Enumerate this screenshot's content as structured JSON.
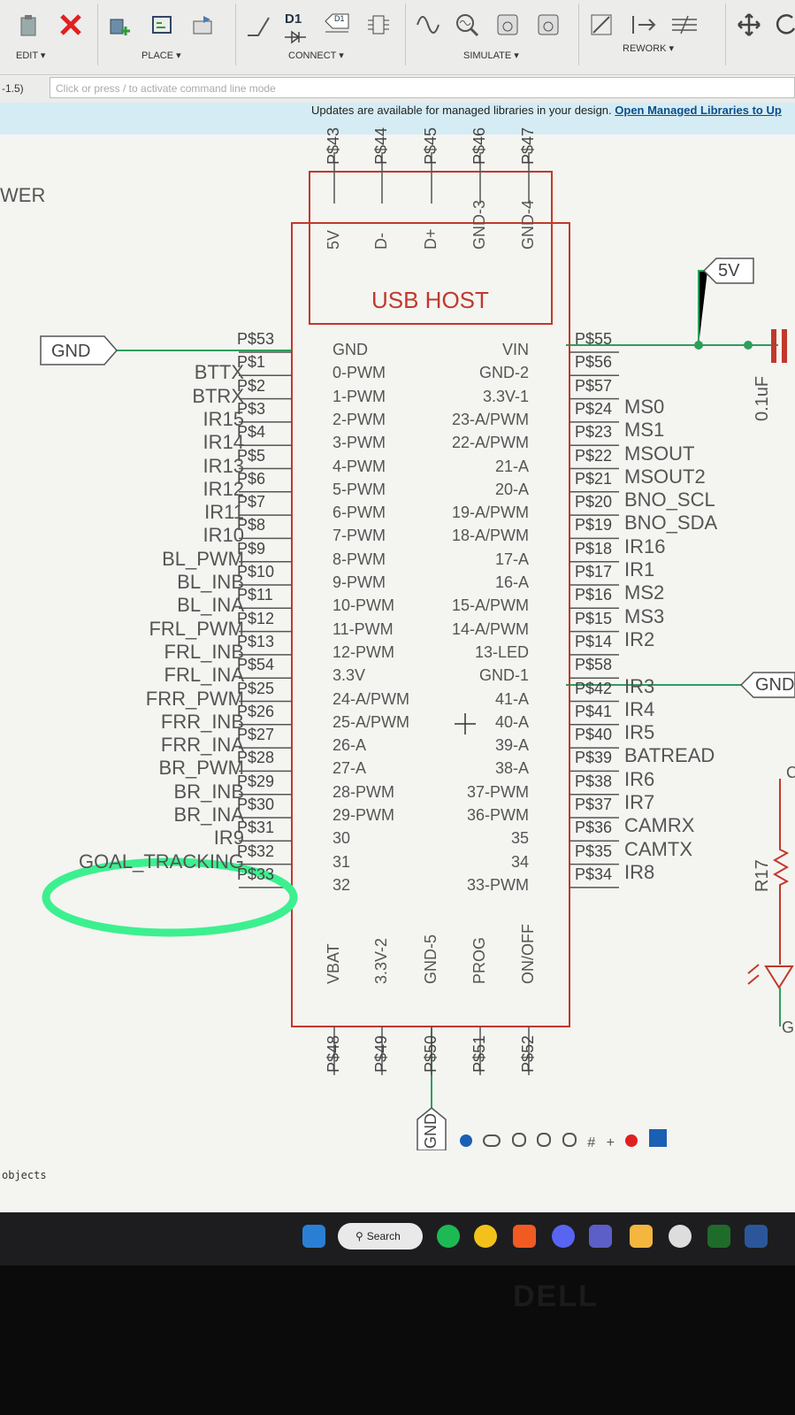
{
  "toolbar": {
    "edit_label": "EDIT ▾",
    "place_label": "PLACE ▾",
    "connect_label": "CONNECT ▾",
    "simulate_label": "SIMULATE ▾",
    "rework_label": "REWORK ▾",
    "d1_label": "D1",
    "d1_box_label": "D1"
  },
  "command": {
    "coordinate": "-1.5)",
    "placeholder": "Click or press / to activate command line mode"
  },
  "banner": {
    "text": "Updates are available for managed libraries in your design.",
    "link": "Open Managed Libraries to Up"
  },
  "schematic": {
    "frame_label": "WER",
    "usb_host_title": "USB HOST",
    "usb_pins": [
      "5V",
      "D-",
      "D+",
      "GND-3",
      "GND-4"
    ],
    "usb_pads": [
      "P$43",
      "P$44",
      "P$45",
      "P$46",
      "P$47"
    ],
    "left_port": "GND",
    "right_port_5v": "5V",
    "right_port_gnd": "GND",
    "bottom_port": "GND",
    "capacitor_value": "0.1uF",
    "resistor_name": "R17",
    "right_edge_letter_g": "G",
    "right_edge_letter_c": "C",
    "left_pins": [
      "GND",
      "0-PWM",
      "1-PWM",
      "2-PWM",
      "3-PWM",
      "4-PWM",
      "5-PWM",
      "6-PWM",
      "7-PWM",
      "8-PWM",
      "9-PWM",
      "10-PWM",
      "11-PWM",
      "12-PWM",
      "3.3V",
      "24-A/PWM",
      "25-A/PWM",
      "26-A",
      "27-A",
      "28-PWM",
      "29-PWM",
      "30",
      "31",
      "32"
    ],
    "left_pads": [
      "P$53",
      "P$1",
      "P$2",
      "P$3",
      "P$4",
      "P$5",
      "P$6",
      "P$7",
      "P$8",
      "P$9",
      "P$10",
      "P$11",
      "P$12",
      "P$13",
      "P$54",
      "P$25",
      "P$26",
      "P$27",
      "P$28",
      "P$29",
      "P$30",
      "P$31",
      "P$32",
      "P$33"
    ],
    "left_nets": [
      "BTTX",
      "BTRX",
      "IR15",
      "IR14",
      "IR13",
      "IR12",
      "IR11",
      "IR10",
      "BL_PWM",
      "BL_INB",
      "BL_INA",
      "FRL_PWM",
      "FRL_INB",
      "FRL_INA",
      "FRR_PWM",
      "FRR_INB",
      "FRR_INA",
      "BR_PWM",
      "BR_INB",
      "BR_INA",
      "IR9",
      "GOAL_TRACKING"
    ],
    "right_pins": [
      "VIN",
      "GND-2",
      "3.3V-1",
      "23-A/PWM",
      "22-A/PWM",
      "21-A",
      "20-A",
      "19-A/PWM",
      "18-A/PWM",
      "17-A",
      "16-A",
      "15-A/PWM",
      "14-A/PWM",
      "13-LED",
      "GND-1",
      "41-A",
      "40-A",
      "39-A",
      "38-A",
      "37-PWM",
      "36-PWM",
      "35",
      "34",
      "33-PWM"
    ],
    "right_pads": [
      "P$55",
      "P$56",
      "P$57",
      "P$24",
      "P$23",
      "P$22",
      "P$21",
      "P$20",
      "P$19",
      "P$18",
      "P$17",
      "P$16",
      "P$15",
      "P$14",
      "P$58",
      "P$42",
      "P$41",
      "P$40",
      "P$39",
      "P$38",
      "P$37",
      "P$36",
      "P$35",
      "P$34"
    ],
    "right_nets": [
      "MS0",
      "MS1",
      "MSOUT",
      "MSOUT2",
      "BNO_SCL",
      "BNO_SDA",
      "IR16",
      "IR1",
      "MS2",
      "MS3",
      "IR2",
      "IR3",
      "IR4",
      "IR5",
      "BATREAD",
      "IR6",
      "IR7",
      "CAMRX",
      "CAMTX",
      "IR8"
    ],
    "bottom_pins": [
      "VBAT",
      "3.3V-2",
      "GND-5",
      "PROG",
      "ON/OFF"
    ],
    "bottom_pads": [
      "P$48",
      "P$49",
      "P$50",
      "P$51",
      "P$52"
    ]
  },
  "status": {
    "text": "objects"
  },
  "taskbar": {
    "search_label": "Search"
  },
  "monitor": {
    "brand": "DELL"
  },
  "colors": {
    "wire": "#2e9e5b",
    "part_outline": "#c0392b",
    "highlight": "#3cf08f",
    "banner_bg": "#d5ecf4"
  }
}
